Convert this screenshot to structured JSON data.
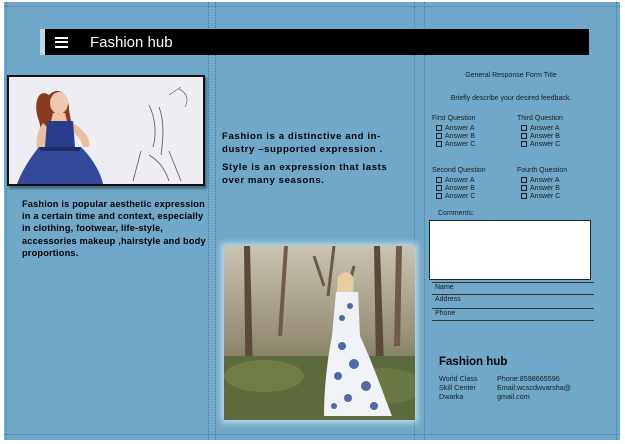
{
  "header": {
    "title": "Fashion hub"
  },
  "column1": {
    "paragraph": "Fashion is popular aesthetic expression in a certain time and context, especially in clothing, footwear, life-style, accessories makeup ,hairstyle and body proportions."
  },
  "column2": {
    "paragraph1": "Fashion is a distinctive and in-dustry –supported expression .",
    "paragraph2": "Style is an expression that lasts over many seasons."
  },
  "form": {
    "title": "General Response Form Title",
    "description": "Briefly describe your desired feedback.",
    "questions": [
      {
        "label": "First Question",
        "answers": [
          "Answer A",
          "Answer B",
          "Answer C"
        ]
      },
      {
        "label": "Third Question",
        "answers": [
          "Answer A",
          "Answer B",
          "Answer C"
        ]
      },
      {
        "label": "Second Question",
        "answers": [
          "Answer A",
          "Answer B",
          "Answer C"
        ]
      },
      {
        "label": "Fourth Question",
        "answers": [
          "Answer A",
          "Answer B",
          "Answer C"
        ]
      }
    ],
    "comments_label": "Comments:",
    "fields": {
      "name": "Name",
      "address": "Address",
      "phone": "Phone"
    }
  },
  "footer": {
    "title": "Fashion hub",
    "address_lines": [
      "World Class",
      "Skill Center",
      "Dwarka"
    ],
    "contact_lines": [
      "Phone:8598665596",
      "Email:wcscdwvarsha@",
      "gmail.com"
    ]
  },
  "colors": {
    "page_background": "#6fa8c8",
    "header_bar": "#000000",
    "guide_lines": "#4a78a8"
  },
  "icons": {
    "menu": "hamburger-menu-icon"
  }
}
